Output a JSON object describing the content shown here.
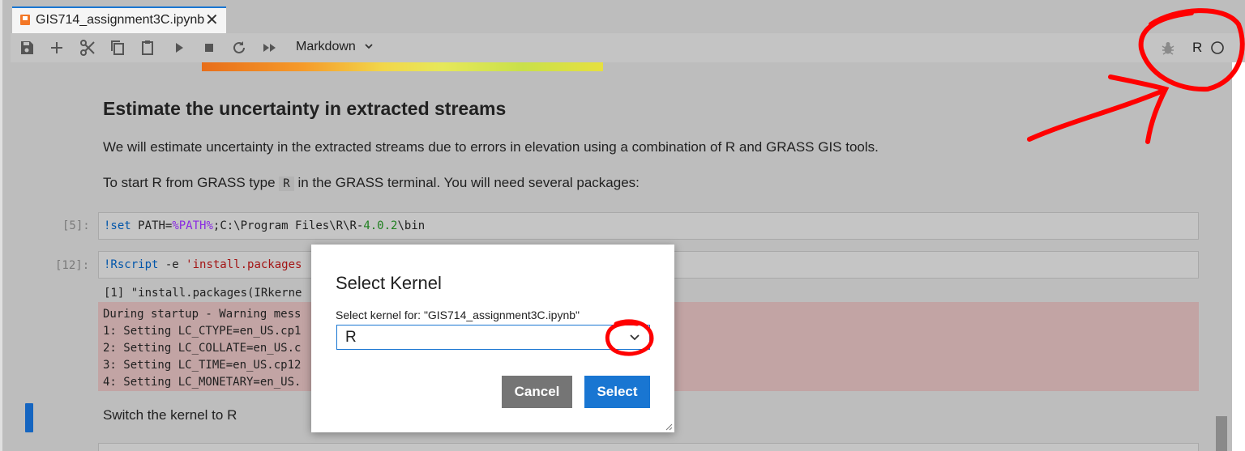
{
  "tab": {
    "title": "GIS714_assignment3C.ipynb",
    "close": "✕"
  },
  "toolbar": {
    "cell_type": "Markdown",
    "kernel_name": "R"
  },
  "markdown": {
    "heading": "Estimate the uncertainty in extracted streams",
    "para1": "We will estimate uncertainty in the extracted streams due to errors in elevation using a combination of R and GRASS GIS tools.",
    "para2_before": "To start R from GRASS type ",
    "para2_code": "R",
    "para2_after": " in the GRASS terminal. You will need several packages:",
    "switch_note": "Switch the kernel to R"
  },
  "cells": [
    {
      "prompt": "[5]:",
      "magic": "!set ",
      "text1": "PATH=",
      "var": "%PATH%",
      "text2": ";C:\\Program Files\\R\\R-",
      "num": "4.0.2",
      "text3": "\\bin"
    },
    {
      "prompt": "[12]:",
      "magic": "!Rscript ",
      "text1": "-e ",
      "str": "'install.packages"
    }
  ],
  "output": {
    "stdout": "[1] \"install.packages(IRkerne",
    "stderr": [
      "During startup - Warning mess",
      "1: Setting LC_CTYPE=en_US.cp1",
      "2: Setting LC_COLLATE=en_US.c",
      "3: Setting LC_TIME=en_US.cp12",
      "4: Setting LC_MONETARY=en_US."
    ]
  },
  "dialog": {
    "title": "Select Kernel",
    "label": "Select kernel for: \"GIS714_assignment3C.ipynb\"",
    "selected": "R",
    "cancel": "Cancel",
    "select": "Select"
  },
  "colors": {
    "accent": "#1976d2",
    "annotation": "#ff0000",
    "stderr_bg": "#c2a4a4"
  }
}
